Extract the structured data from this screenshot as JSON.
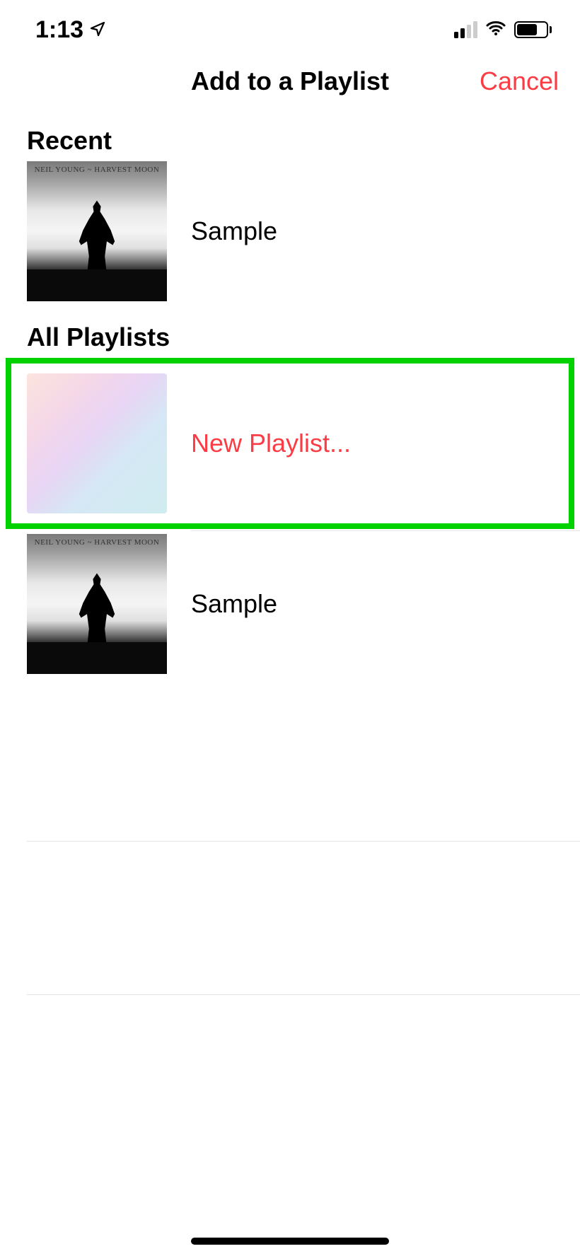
{
  "status_bar": {
    "time": "1:13",
    "signal_strength": 2,
    "wifi": true,
    "battery_percent": 70
  },
  "nav": {
    "title": "Add to a Playlist",
    "cancel_label": "Cancel"
  },
  "sections": {
    "recent": {
      "header": "Recent",
      "items": [
        {
          "name": "Sample",
          "album_text": "NEIL YOUNG ~ HARVEST MOON"
        }
      ]
    },
    "all_playlists": {
      "header": "All Playlists",
      "new_playlist_label": "New Playlist...",
      "items": [
        {
          "name": "Sample",
          "album_text": "NEIL YOUNG ~ HARVEST MOON"
        }
      ]
    }
  },
  "highlight": {
    "target": "new-playlist-button",
    "color": "#00d200"
  },
  "colors": {
    "accent": "#fc3c44",
    "highlight": "#00d200"
  }
}
